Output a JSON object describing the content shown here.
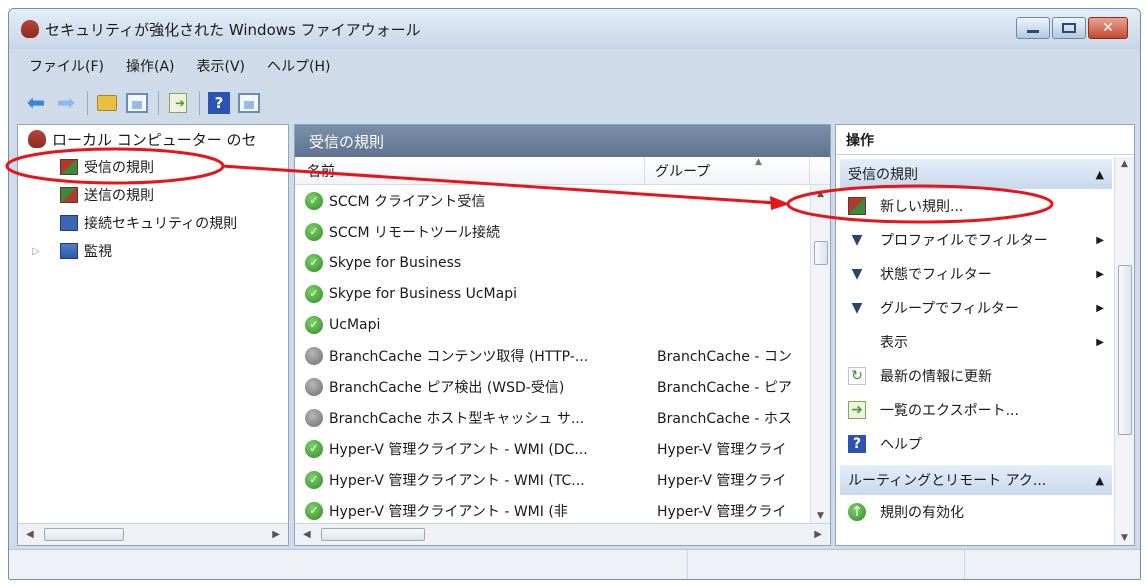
{
  "window": {
    "title": "セキュリティが強化された Windows ファイアウォール",
    "icon": "firewall-shield-icon",
    "controls": [
      "minimize-icon",
      "maximize-icon",
      "close-icon"
    ]
  },
  "menu": {
    "file": "ファイル(F)",
    "action": "操作(A)",
    "view": "表示(V)",
    "help": "ヘルプ(H)"
  },
  "toolbar": {
    "help_label": "?"
  },
  "tree": {
    "root": "ローカル コンピューター のセ",
    "items": [
      {
        "label": "受信の規則",
        "icon": "inbound-rules-icon"
      },
      {
        "label": "送信の規則",
        "icon": "outbound-rules-icon"
      },
      {
        "label": "接続セキュリティの規則",
        "icon": "connection-security-icon"
      },
      {
        "label": "監視",
        "icon": "monitoring-icon"
      }
    ]
  },
  "main": {
    "title": "受信の規則",
    "columns": {
      "name": "名前",
      "group": "グループ"
    },
    "rows": [
      {
        "name": "SCCM クライアント受信",
        "group": "",
        "enabled": true
      },
      {
        "name": "SCCM リモートツール接続",
        "group": "",
        "enabled": true
      },
      {
        "name": "Skype for Business",
        "group": "",
        "enabled": true
      },
      {
        "name": "Skype for Business UcMapi",
        "group": "",
        "enabled": true
      },
      {
        "name": "UcMapi",
        "group": "",
        "enabled": true
      },
      {
        "name": "BranchCache コンテンツ取得 (HTTP-...",
        "group": "BranchCache - コン",
        "enabled": false
      },
      {
        "name": "BranchCache ピア検出 (WSD-受信)",
        "group": "BranchCache - ピア",
        "enabled": false
      },
      {
        "name": "BranchCache ホスト型キャッシュ サ...",
        "group": "BranchCache - ホス",
        "enabled": false
      },
      {
        "name": "Hyper-V 管理クライアント - WMI (DC...",
        "group": "Hyper-V 管理クライ",
        "enabled": true
      },
      {
        "name": "Hyper-V 管理クライアント - WMI (TC...",
        "group": "Hyper-V 管理クライ",
        "enabled": true
      },
      {
        "name": "Hyper-V 管理クライアント - WMI (非",
        "group": "Hyper-V 管理クライ",
        "enabled": true
      }
    ]
  },
  "actions": {
    "title": "操作",
    "section1": "受信の規則",
    "items": [
      {
        "label": "新しい規則...",
        "icon": "new-rule-icon",
        "submenu": false
      },
      {
        "label": "プロファイルでフィルター",
        "icon": "filter-icon",
        "submenu": true
      },
      {
        "label": "状態でフィルター",
        "icon": "filter-icon",
        "submenu": true
      },
      {
        "label": "グループでフィルター",
        "icon": "filter-icon",
        "submenu": true
      },
      {
        "label": "表示",
        "icon": "",
        "submenu": true
      },
      {
        "label": "最新の情報に更新",
        "icon": "refresh-icon",
        "submenu": false
      },
      {
        "label": "一覧のエクスポート...",
        "icon": "export-icon",
        "submenu": false
      },
      {
        "label": "ヘルプ",
        "icon": "help-icon",
        "submenu": false
      }
    ],
    "section2": "ルーティングとリモート アク...",
    "section2_items": [
      {
        "label": "規則の有効化",
        "icon": "enable-rule-icon"
      }
    ]
  },
  "colors": {
    "annotation": "#e8141b",
    "enabled": "#2f8a24",
    "disabled": "#6d6d6d"
  }
}
